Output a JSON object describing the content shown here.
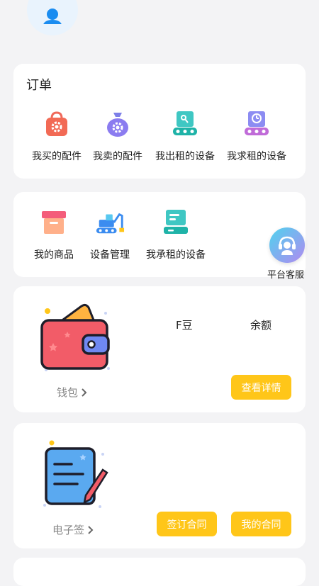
{
  "orders": {
    "title": "订单",
    "items": [
      {
        "label": "我买的配件",
        "icon": "bag-gear-icon"
      },
      {
        "label": "我卖的配件",
        "icon": "money-bag-gear-icon"
      },
      {
        "label": "我出租的设备",
        "icon": "rent-out-device-icon"
      },
      {
        "label": "我求租的设备",
        "icon": "rent-in-device-icon"
      }
    ]
  },
  "tools": {
    "items": [
      {
        "label": "我的商品",
        "icon": "goods-box-icon"
      },
      {
        "label": "设备管理",
        "icon": "excavator-icon"
      },
      {
        "label": "我承租的设备",
        "icon": "leased-device-icon"
      }
    ]
  },
  "service": {
    "label": "平台客服",
    "icon": "customer-service-icon"
  },
  "wallet": {
    "fdou_label": "F豆",
    "balance_label": "余额",
    "link_label": "钱包",
    "detail_button": "查看详情",
    "icon": "wallet-icon"
  },
  "esign": {
    "link_label": "电子签",
    "sign_button": "签订合同",
    "my_contracts_button": "我的合同",
    "icon": "contract-pen-icon"
  },
  "colors": {
    "accent": "#ffc619",
    "background": "#f3f3f5"
  }
}
